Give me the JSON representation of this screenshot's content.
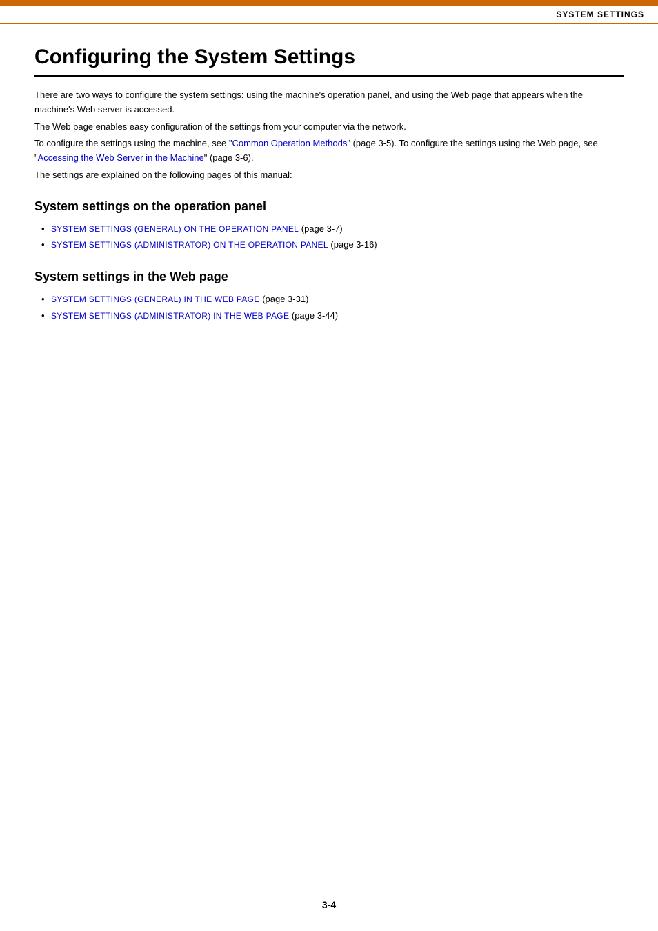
{
  "header": {
    "title": "SYSTEM SETTINGS"
  },
  "page": {
    "title": "Configuring the System Settings",
    "intro": [
      "There are two ways to configure the system settings: using the machine's operation panel, and using the Web page that appears when the machine's Web server is accessed.",
      "The Web page enables easy configuration of the settings from your computer via the network.",
      "To configure the settings using the machine, see \"Common Operation Methods\" (page 3-5). To configure the settings using the Web page, see \"Accessing the Web Server in the Machine\" (page 3-6).",
      "The settings are explained on the following pages of this manual:"
    ],
    "intro_line2": "The Web page enables easy configuration of the settings from your computer via the network.",
    "intro_line3_prefix": "To configure the settings using the machine, see \"",
    "intro_line3_link1": "Common Operation Methods",
    "intro_line3_mid": "\" (page 3-5). To configure the settings using the Web page, see \"",
    "intro_line3_link2": "Accessing the Web Server in the Machine",
    "intro_line3_suffix": "\" (page 3-6).",
    "intro_line4": "The settings are explained on the following pages of this manual:",
    "section1": {
      "heading": "System settings on the operation panel",
      "items": [
        {
          "link_text": "SYSTEM SETTINGS (GENERAL) ON THE OPERATION PANEL",
          "page_ref": " (page 3-7)"
        },
        {
          "link_text": "SYSTEM SETTINGS (ADMINISTRATOR) ON THE OPERATION PANEL",
          "page_ref": " (page 3-16)"
        }
      ]
    },
    "section2": {
      "heading": "System settings in the Web page",
      "items": [
        {
          "link_text": "SYSTEM SETTINGS (GENERAL) IN THE WEB PAGE",
          "page_ref": " (page 3-31)"
        },
        {
          "link_text": "SYSTEM SETTINGS (ADMINISTRATOR) IN THE WEB PAGE",
          "page_ref": " (page 3-44)"
        }
      ]
    },
    "page_number": "3-4"
  }
}
